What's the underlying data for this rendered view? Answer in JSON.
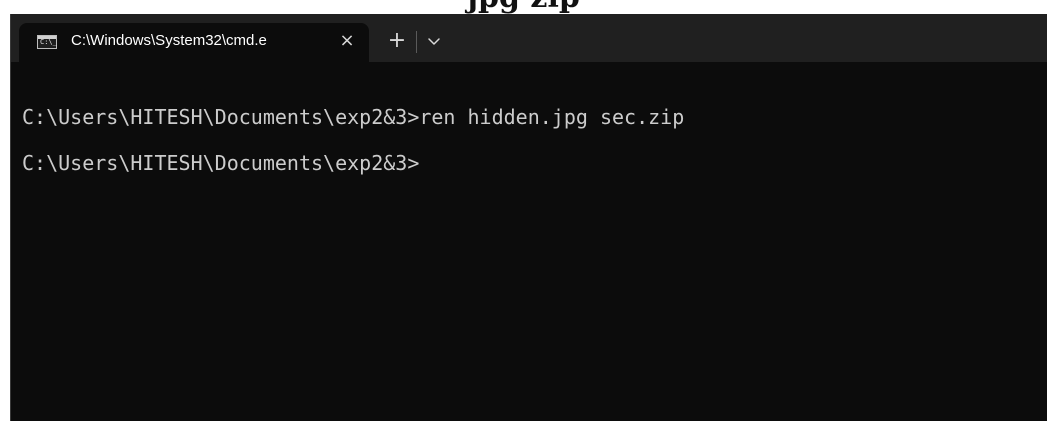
{
  "backdrop": {
    "heading_fragment": "jpg   zip"
  },
  "tab": {
    "icon": "cmd-icon",
    "icon_glyph": "C:\\_",
    "title": "C:\\Windows\\System32\\cmd.e",
    "close_label": "×"
  },
  "tabbar": {
    "new_tab_label": "+",
    "dropdown_icon": "chevron-down-icon"
  },
  "console": {
    "lines": [
      "C:\\Users\\HITESH\\Documents\\exp2&3>ren hidden.jpg sec.zip",
      "C:\\Users\\HITESH\\Documents\\exp2&3>"
    ]
  },
  "colors": {
    "tabbar_bg": "#202020",
    "console_bg": "#0c0c0c",
    "console_text": "#cccccc"
  }
}
